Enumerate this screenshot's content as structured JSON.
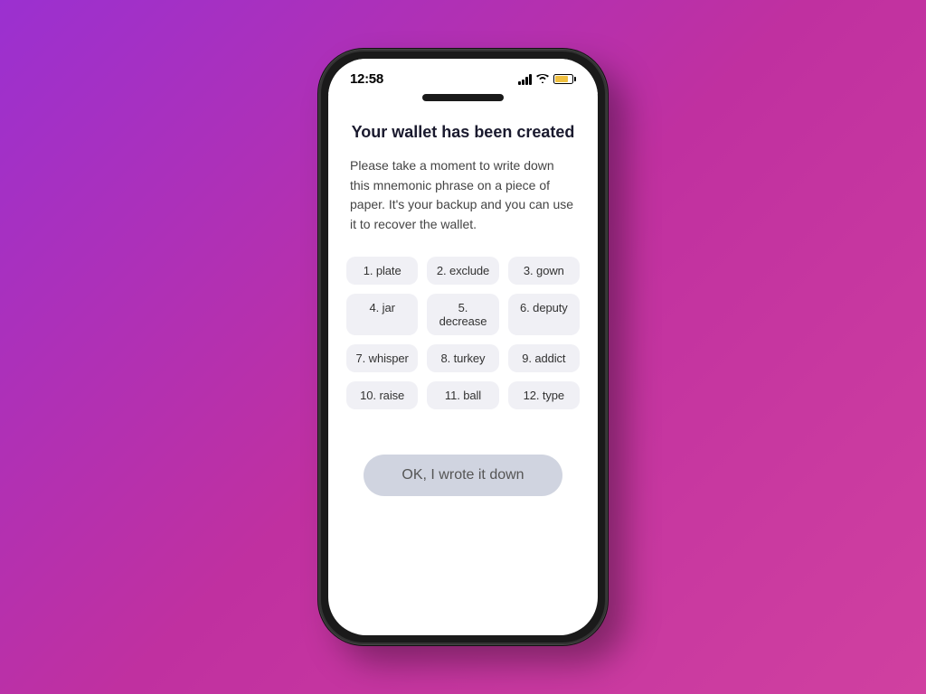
{
  "phone": {
    "status_bar": {
      "time": "12:58",
      "signal_label": "signal",
      "wifi_label": "wifi",
      "battery_label": "battery"
    },
    "screen": {
      "title": "Your wallet has been created",
      "description": "Please take a moment to write down this mnemonic phrase on a piece of paper. It's your backup and you can use it to recover the wallet.",
      "mnemonic_words": [
        {
          "number": 1,
          "label": "1. plate"
        },
        {
          "number": 2,
          "label": "2. exclude"
        },
        {
          "number": 3,
          "label": "3. gown"
        },
        {
          "number": 4,
          "label": "4. jar"
        },
        {
          "number": 5,
          "label": "5. decrease"
        },
        {
          "number": 6,
          "label": "6. deputy"
        },
        {
          "number": 7,
          "label": "7. whisper"
        },
        {
          "number": 8,
          "label": "8. turkey"
        },
        {
          "number": 9,
          "label": "9. addict"
        },
        {
          "number": 10,
          "label": "10. raise"
        },
        {
          "number": 11,
          "label": "11. ball"
        },
        {
          "number": 12,
          "label": "12. type"
        }
      ],
      "ok_button_label": "OK, I wrote it down"
    }
  }
}
